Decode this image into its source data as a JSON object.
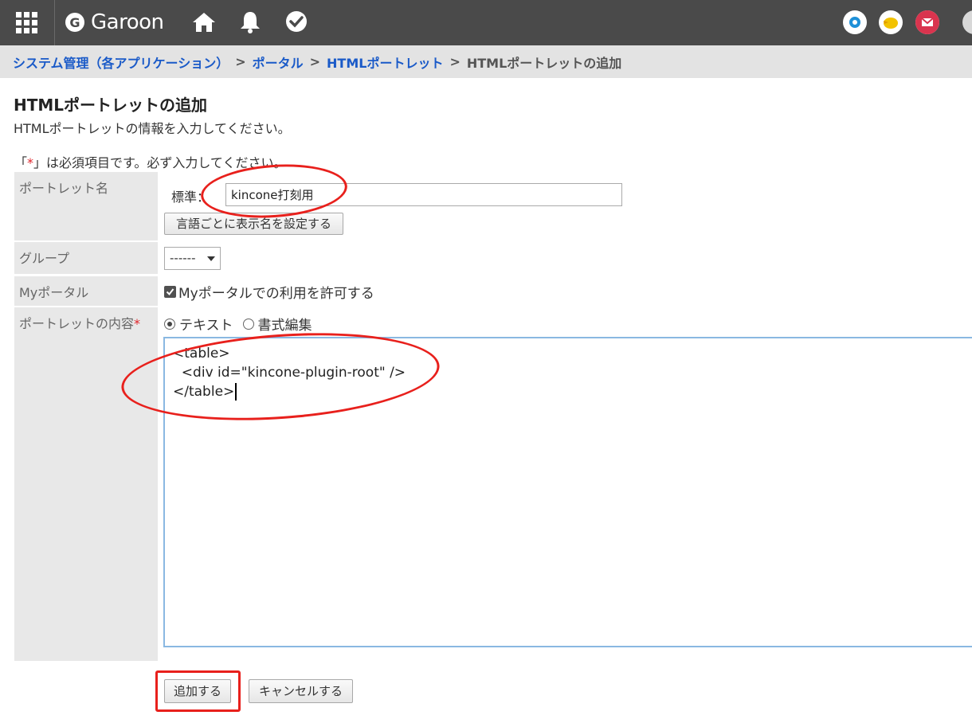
{
  "header": {
    "logo_letter": "G",
    "logo_text": "Garoon",
    "icons": [
      "apps-grid-icon",
      "home-icon",
      "bell-icon",
      "check-bubble-icon",
      "ring-status-icon",
      "bird-avatar-icon",
      "mail-icon"
    ]
  },
  "breadcrumb": {
    "items": [
      "システム管理（各アプリケーション）",
      "ポータル",
      "HTMLポートレット"
    ],
    "current": "HTMLポートレットの追加",
    "separator": ">"
  },
  "page": {
    "title": "HTMLポートレットの追加",
    "description": "HTMLポートレットの情報を入力してください。",
    "required_note_pre": "「",
    "required_star": "*",
    "required_note_post": "」は必須項目です。必ず入力してください。"
  },
  "form": {
    "portlet_name_label": "ポートレット名",
    "standard_label": "標準：",
    "portlet_name_value": "kincone打刻用",
    "lang_button": "言語ごとに表示名を設定する",
    "group_label": "グループ",
    "group_value": "------",
    "myportal_label": "Myポータル",
    "myportal_checkbox": "Myポータルでの利用を許可する",
    "content_label": "ポートレットの内容",
    "content_required": "*",
    "radio_text": "テキスト",
    "radio_format": "書式編集",
    "content_lines": [
      "<table>",
      "  <div id=\"kincone-plugin-root\" />",
      "</table>"
    ],
    "add_button": "追加する",
    "cancel_button": "キャンセルする"
  },
  "colors": {
    "header_bg": "#4a4a4a",
    "breadcrumb_link": "#1a5ac8",
    "annotation": "#e8201c",
    "label_bg": "#e8e8e8"
  }
}
